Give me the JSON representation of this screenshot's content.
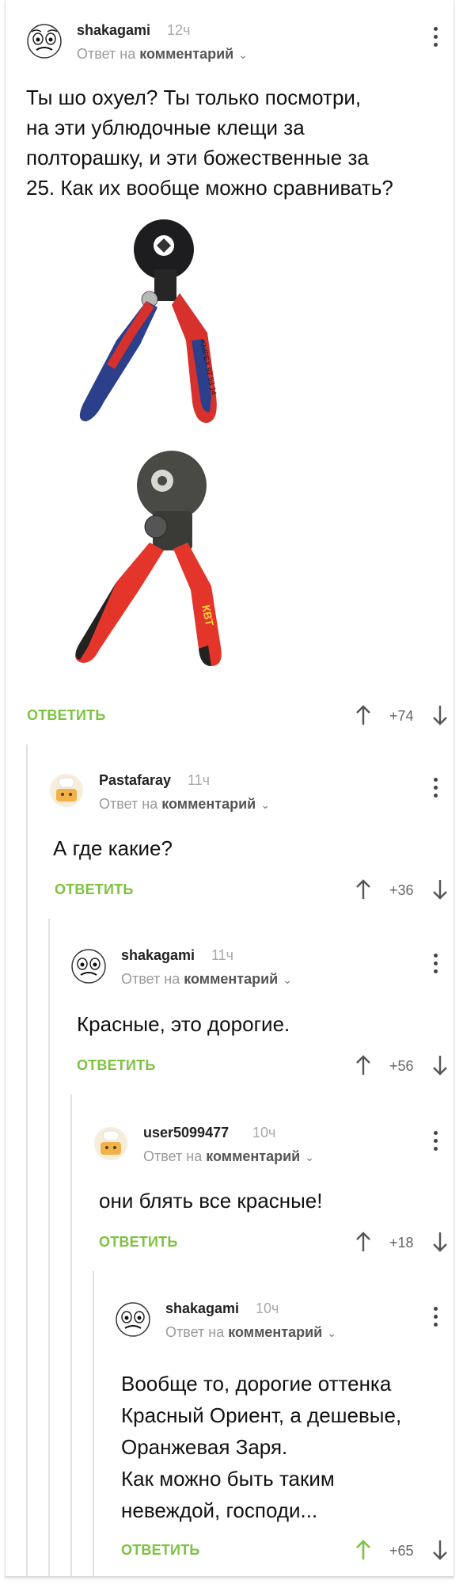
{
  "comments": [
    {
      "author": "shakagami",
      "time": "12ч",
      "reply_prefix": "Ответ на",
      "reply_target": "комментарий",
      "text_lines": [
        "Ты шо охуел? Ты только посмотри,",
        "на эти ублюдочные клещи за",
        "полторашку, и эти божественные за",
        "25. Как их вообще можно сравнивать?"
      ],
      "images": [
        {
          "brand_text": "KNIPEX 97 53 14",
          "color": "#d6312c",
          "accent": "#2b3f8a"
        },
        {
          "brand_text": "КВТ",
          "color": "#e4352a",
          "accent": "#222222"
        }
      ],
      "reply_label": "ОТВЕТИТЬ",
      "votes": "+74",
      "up_active": false
    },
    {
      "author": "Pastafaray",
      "time": "11ч",
      "reply_prefix": "Ответ на",
      "reply_target": "комментарий",
      "text_lines": [
        "А где какие?"
      ],
      "reply_label": "ОТВЕТИТЬ",
      "votes": "+36",
      "up_active": false
    },
    {
      "author": "shakagami",
      "time": "11ч",
      "reply_prefix": "Ответ на",
      "reply_target": "комментарий",
      "text_lines": [
        "Красные, это дорогие."
      ],
      "reply_label": "ОТВЕТИТЬ",
      "votes": "+56",
      "up_active": false
    },
    {
      "author": "user5099477",
      "time": "10ч",
      "reply_prefix": "Ответ на",
      "reply_target": "комментарий",
      "text_lines": [
        "они блять все красные!"
      ],
      "reply_label": "ОТВЕТИТЬ",
      "votes": "+18",
      "up_active": false
    },
    {
      "author": "shakagami",
      "time": "10ч",
      "reply_prefix": "Ответ на",
      "reply_target": "комментарий",
      "text_lines": [
        "Вообще то, дорогие оттенка",
        "Красный Ориент, а дешевые,",
        "Оранжевая Заря.",
        "Как можно быть таким",
        "невеждой, господи..."
      ],
      "reply_label": "ОТВЕТИТЬ",
      "votes": "+65",
      "up_active": true
    }
  ],
  "colors": {
    "green": "#7dc241",
    "muted": "#9a9a9a",
    "text": "#111111"
  },
  "icons": {
    "avatar_shakagami": "rage-face-icon",
    "avatar_default": "chef-cat-icon",
    "menu": "more-vertical-icon",
    "up": "arrow-up-icon",
    "down": "arrow-down-icon"
  }
}
